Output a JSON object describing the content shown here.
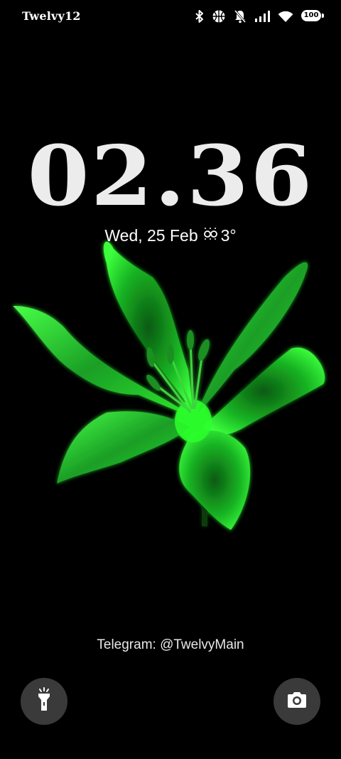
{
  "status_bar": {
    "carrier": "Twelvy12",
    "battery": "100",
    "icons": [
      "bluetooth-icon",
      "basketball-icon",
      "bell-muted-icon",
      "signal-icon",
      "wifi-icon",
      "battery-icon"
    ]
  },
  "lock_screen": {
    "time": "02.36",
    "date": "Wed, 25 Feb",
    "weather_icon": "weather-icon",
    "temperature": "3°",
    "owner_info": "Telegram: @TwelvyMain"
  },
  "shortcuts": {
    "left": "flashlight-icon",
    "right": "camera-icon"
  },
  "colors": {
    "background": "#000000",
    "flower": "#2bff2b",
    "shortcut_bg": "#3a3a3a"
  }
}
